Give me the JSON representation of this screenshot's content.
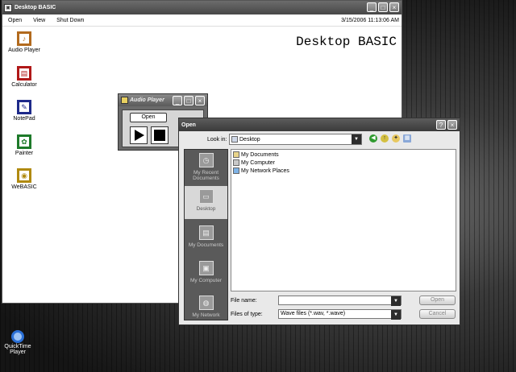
{
  "main_window": {
    "title": "Desktop BASIC",
    "menu": [
      "Open",
      "View",
      "Shut Down"
    ],
    "datetime": "3/15/2006 11:13:06 AM",
    "header": "Desktop BASIC",
    "launchers": [
      {
        "label": "Audio Player",
        "icon": "audio-player-icon",
        "color": "#b26a1e"
      },
      {
        "label": "Calculator",
        "icon": "calculator-icon",
        "color": "#b01818"
      },
      {
        "label": "NotePad",
        "icon": "notepad-icon",
        "color": "#1e2a8a"
      },
      {
        "label": "Painter",
        "icon": "painter-icon",
        "color": "#1e7a2a"
      },
      {
        "label": "WeBASIC",
        "icon": "webasic-icon",
        "color": "#b08a10"
      }
    ]
  },
  "audio_player": {
    "title": "Audio Player",
    "open_label": "Open"
  },
  "open_dialog": {
    "title": "Open",
    "look_in_label": "Look in:",
    "look_in_value": "Desktop",
    "places": [
      "My Recent Documents",
      "Desktop",
      "My Documents",
      "My Computer",
      "My Network"
    ],
    "selected_place": "Desktop",
    "files": [
      "My Documents",
      "My Computer",
      "My Network Places"
    ],
    "file_name_label": "File name:",
    "file_name_value": "",
    "files_of_type_label": "Files of type:",
    "files_of_type_value": "Wave files (*.wav, *.wave)",
    "open_button": "Open",
    "cancel_button": "Cancel"
  },
  "desktop": {
    "quicktime_label": "QuickTime Player"
  }
}
